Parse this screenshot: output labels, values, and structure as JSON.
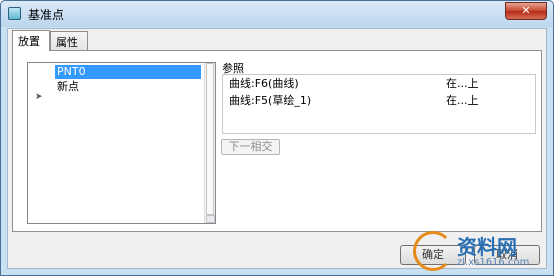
{
  "window": {
    "title": "基准点",
    "close_label": "✕"
  },
  "tabs": [
    {
      "label": "放置"
    },
    {
      "label": "属性"
    }
  ],
  "point_list": {
    "items": [
      {
        "label": "PNT0"
      },
      {
        "label": "新点"
      }
    ],
    "arrow_marker": "➤"
  },
  "references": {
    "label": "参照",
    "rows": [
      {
        "name": "曲线:F6(曲线)",
        "type": "在...上"
      },
      {
        "name": "曲线:F5(草绘_1)",
        "type": "在...上"
      }
    ]
  },
  "next_intersection_label": "下一相交",
  "buttons": {
    "ok_label": "确定",
    "cancel_label": "取消"
  },
  "watermark": {
    "text": "资料网",
    "subtext": "zl.xs1616.com"
  },
  "colors": {
    "selection": "#3399ff",
    "title_bar": "#c9dff2",
    "close_button": "#c6452f"
  }
}
